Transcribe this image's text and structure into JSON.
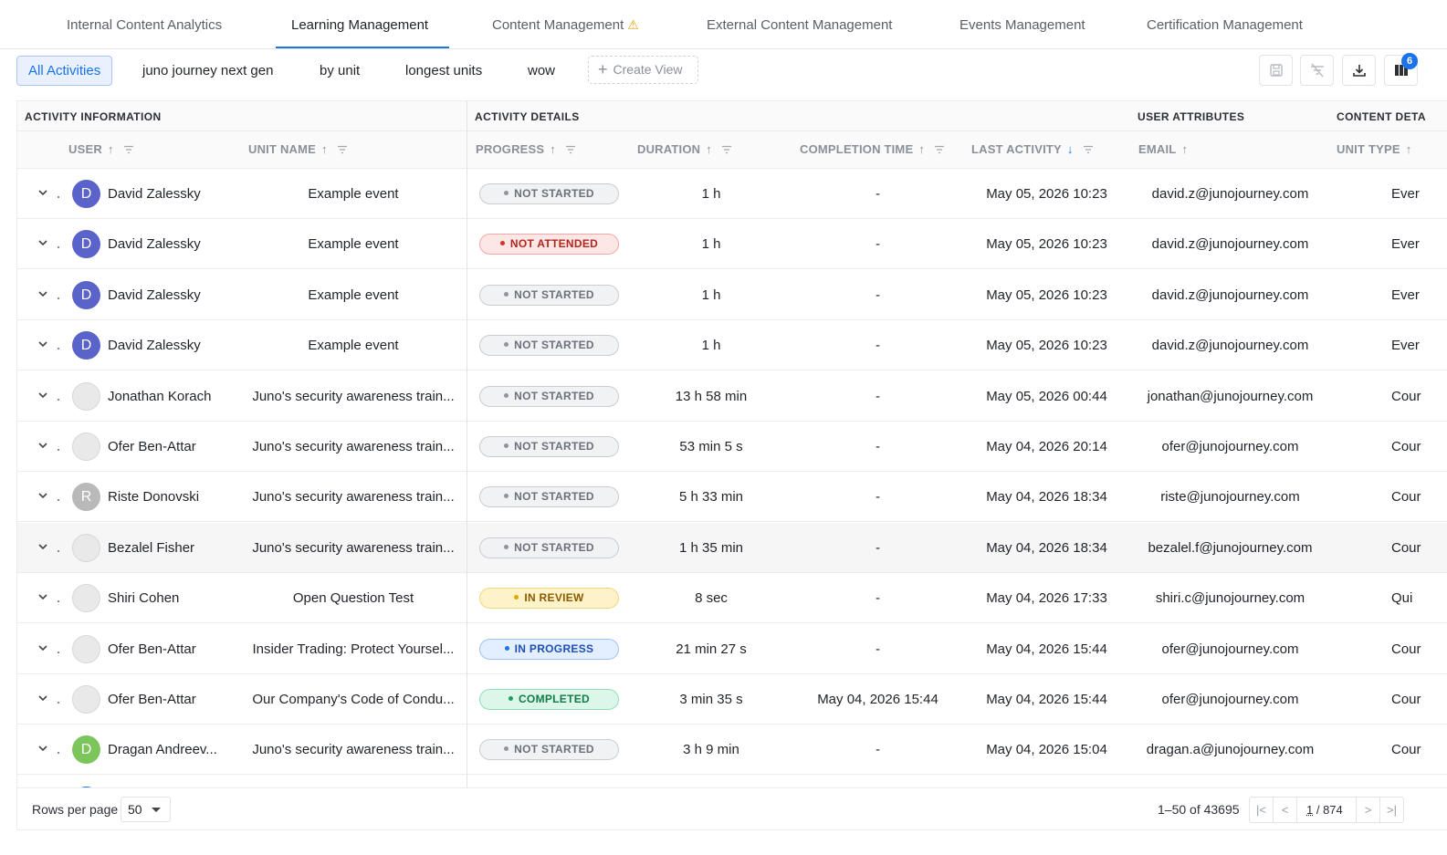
{
  "tabs": [
    {
      "label": "Internal Content Analytics"
    },
    {
      "label": "Learning Management"
    },
    {
      "label": "Content Management",
      "warning": true
    },
    {
      "label": "External Content Management"
    },
    {
      "label": "Events Management"
    },
    {
      "label": "Certification Management"
    }
  ],
  "active_tab": "Learning Management",
  "views": [
    "All Activities",
    "juno journey next gen",
    "by unit",
    "longest units",
    "wow"
  ],
  "active_view": "All Activities",
  "create_view_label": "Create View",
  "columns_badge": "6",
  "groups": {
    "activity_information": "ACTIVITY INFORMATION",
    "activity_details": "ACTIVITY DETAILS",
    "user_attributes": "USER ATTRIBUTES",
    "content_details": "CONTENT DETA"
  },
  "columns": {
    "user": "USER",
    "unit_name": "UNIT NAME",
    "progress": "PROGRESS",
    "duration": "DURATION",
    "completion_time": "COMPLETION TIME",
    "last_activity": "LAST ACTIVITY",
    "email": "EMAIL",
    "unit_type": "UNIT TYPE"
  },
  "status_colors": {
    "NOT STARTED": {
      "bg": "#f1f2f4",
      "border": "#c9cdd2",
      "text": "#6b717a",
      "dot": "#8f959c"
    },
    "NOT ATTENDED": {
      "bg": "#fde6e6",
      "border": "#f4a7a7",
      "text": "#b3261e",
      "dot": "#d93025"
    },
    "IN REVIEW": {
      "bg": "#fdf2c8",
      "border": "#f1d77e",
      "text": "#8a5a00",
      "dot": "#e0a800"
    },
    "IN PROGRESS": {
      "bg": "#e3efff",
      "border": "#9ec2f5",
      "text": "#1f4fb5",
      "dot": "#1a73e8"
    },
    "COMPLETED": {
      "bg": "#dcf7ea",
      "border": "#92dfb9",
      "text": "#137a46",
      "dot": "#1e9e5c"
    }
  },
  "rows": [
    {
      "user": "David Zalessky",
      "avatar": "D",
      "avatar_color": "#5a63c9",
      "unit": "Example event",
      "status": "NOT STARTED",
      "duration": "1 h",
      "completion": "-",
      "last": "May 05, 2026 10:23",
      "email": "david.z@junojourney.com",
      "type": "Ever"
    },
    {
      "user": "David Zalessky",
      "avatar": "D",
      "avatar_color": "#5a63c9",
      "unit": "Example event",
      "status": "NOT ATTENDED",
      "duration": "1 h",
      "completion": "-",
      "last": "May 05, 2026 10:23",
      "email": "david.z@junojourney.com",
      "type": "Ever"
    },
    {
      "user": "David Zalessky",
      "avatar": "D",
      "avatar_color": "#5a63c9",
      "unit": "Example event",
      "status": "NOT STARTED",
      "duration": "1 h",
      "completion": "-",
      "last": "May 05, 2026 10:23",
      "email": "david.z@junojourney.com",
      "type": "Ever"
    },
    {
      "user": "David Zalessky",
      "avatar": "D",
      "avatar_color": "#5a63c9",
      "unit": "Example event",
      "status": "NOT STARTED",
      "duration": "1 h",
      "completion": "-",
      "last": "May 05, 2026 10:23",
      "email": "david.z@junojourney.com",
      "type": "Ever"
    },
    {
      "user": "Jonathan Korach",
      "avatar": "",
      "avatar_color": "photo",
      "unit": "Juno's security awareness train...",
      "status": "NOT STARTED",
      "duration": "13 h 58 min",
      "completion": "-",
      "last": "May 05, 2026 00:44",
      "email": "jonathan@junojourney.com",
      "type": "Cour"
    },
    {
      "user": "Ofer Ben-Attar",
      "avatar": "",
      "avatar_color": "photo",
      "unit": "Juno's security awareness train...",
      "status": "NOT STARTED",
      "duration": "53 min 5 s",
      "completion": "-",
      "last": "May 04, 2026 20:14",
      "email": "ofer@junojourney.com",
      "type": "Cour"
    },
    {
      "user": "Riste Donovski",
      "avatar": "R",
      "avatar_color": "#b9b9b9",
      "unit": "Juno's security awareness train...",
      "status": "NOT STARTED",
      "duration": "5 h 33 min",
      "completion": "-",
      "last": "May 04, 2026 18:34",
      "email": "riste@junojourney.com",
      "type": "Cour"
    },
    {
      "user": "Bezalel Fisher",
      "avatar": "",
      "avatar_color": "photo",
      "unit": "Juno's security awareness train...",
      "status": "NOT STARTED",
      "duration": "1 h 35 min",
      "completion": "-",
      "last": "May 04, 2026 18:34",
      "email": "bezalel.f@junojourney.com",
      "type": "Cour"
    },
    {
      "user": "Shiri Cohen",
      "avatar": "",
      "avatar_color": "photo",
      "unit": "Open Question Test",
      "status": "IN REVIEW",
      "duration": "8 sec",
      "completion": "-",
      "last": "May 04, 2026 17:33",
      "email": "shiri.c@junojourney.com",
      "type": "Qui"
    },
    {
      "user": "Ofer Ben-Attar",
      "avatar": "",
      "avatar_color": "photo",
      "unit": "Insider Trading: Protect Yoursel...",
      "status": "IN PROGRESS",
      "duration": "21 min 27 s",
      "completion": "-",
      "last": "May 04, 2026 15:44",
      "email": "ofer@junojourney.com",
      "type": "Cour"
    },
    {
      "user": "Ofer Ben-Attar",
      "avatar": "",
      "avatar_color": "photo",
      "unit": "Our Company's Code of Condu...",
      "status": "COMPLETED",
      "duration": "3 min 35 s",
      "completion": "May 04, 2026 15:44",
      "last": "May 04, 2026 15:44",
      "email": "ofer@junojourney.com",
      "type": "Cour"
    },
    {
      "user": "Dragan Andreev...",
      "avatar": "D",
      "avatar_color": "#7cc55a",
      "unit": "Juno's security awareness train...",
      "status": "NOT STARTED",
      "duration": "3 h 9 min",
      "completion": "-",
      "last": "May 04, 2026 15:04",
      "email": "dragan.a@junojourney.com",
      "type": "Cour"
    }
  ],
  "footer": {
    "rows_per_page_label": "Rows per page",
    "rows_per_page": "50",
    "range": "1–50 of 43695",
    "current_page": "1",
    "total_pages": "874"
  }
}
